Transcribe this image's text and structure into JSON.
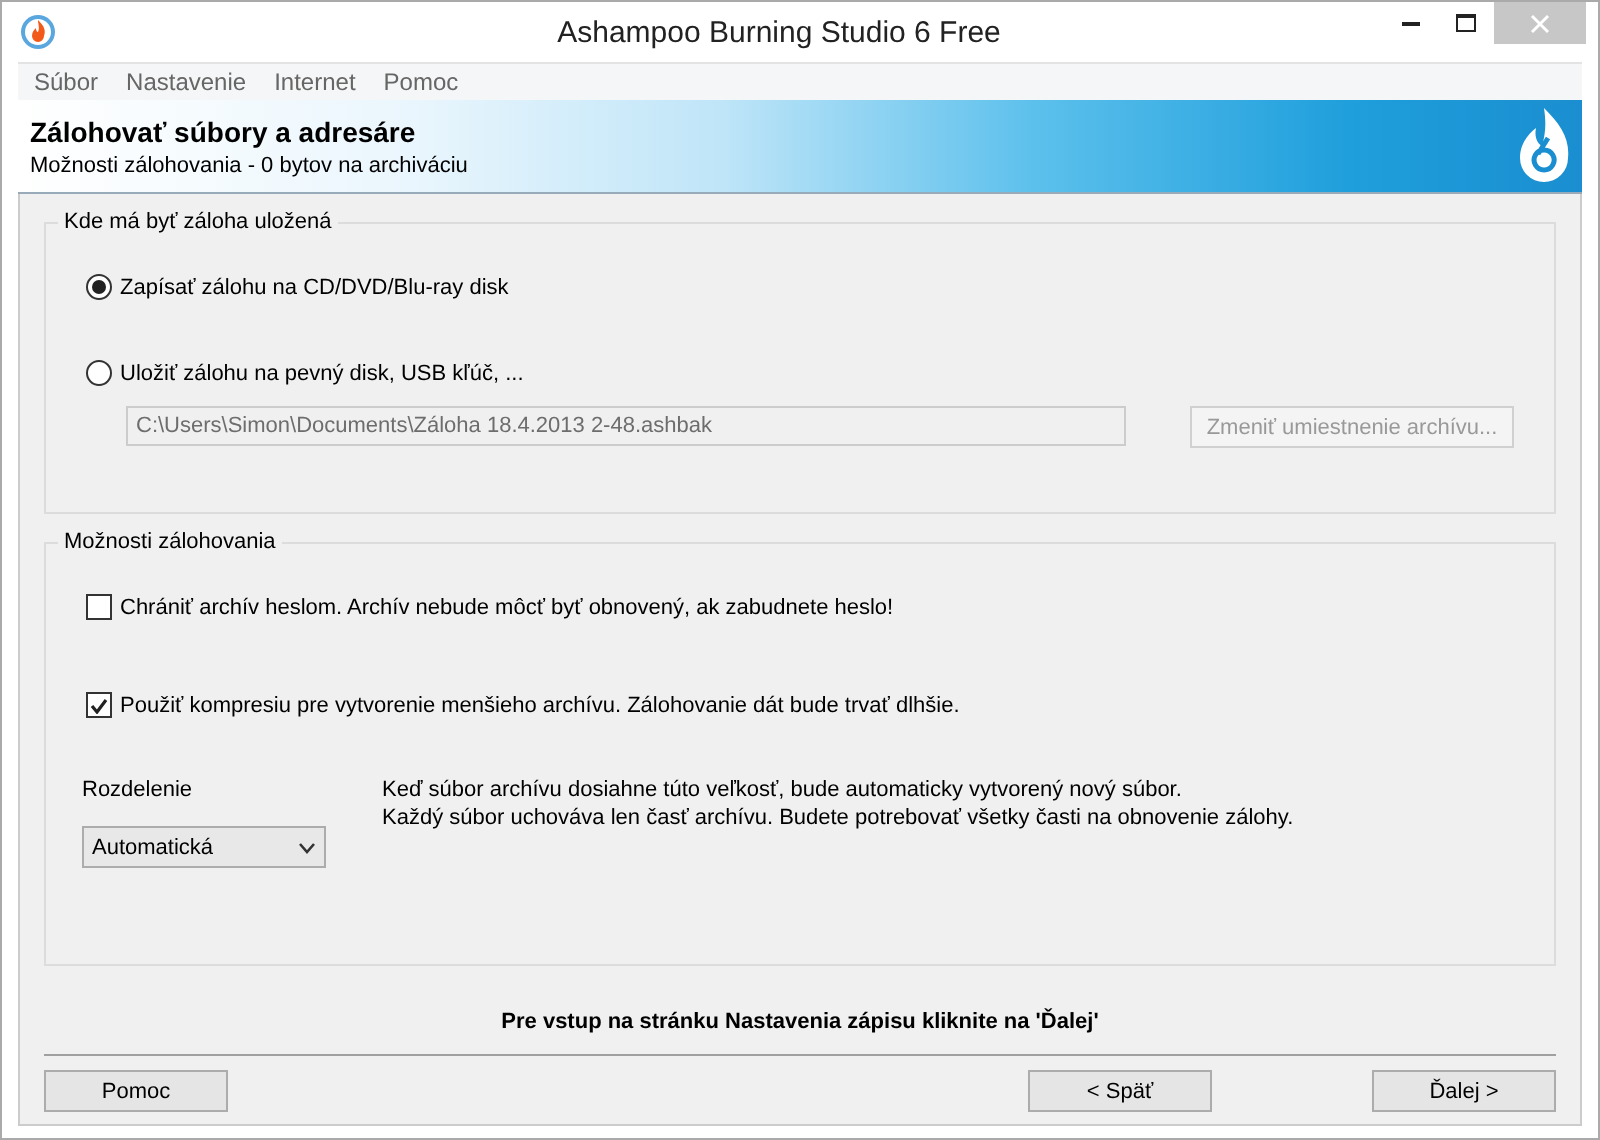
{
  "window": {
    "title": "Ashampoo Burning Studio 6 Free"
  },
  "menu": [
    {
      "label": "Súbor"
    },
    {
      "label": "Nastavenie"
    },
    {
      "label": "Internet"
    },
    {
      "label": "Pomoc"
    }
  ],
  "banner": {
    "title": "Zálohovať súbory a adresáre",
    "subtitle": "Možnosti zálohovania - 0 bytov na archiváciu"
  },
  "location_group": {
    "title": "Kde má byť záloha uložená",
    "options": [
      {
        "label": "Zapísať zálohu na CD/DVD/Blu-ray disk",
        "selected": true
      },
      {
        "label": "Uložiť zálohu na pevný disk, USB kľúč, ...",
        "selected": false
      }
    ],
    "path_field": {
      "value": "C:\\Users\\Simon\\Documents\\Záloha 18.4.2013 2-48.ashbak",
      "disabled": true
    },
    "change_button": {
      "label": "Zmeniť umiestnenie archívu...",
      "disabled": true
    }
  },
  "options_group": {
    "title": "Možnosti zálohovania",
    "checkboxes": [
      {
        "label": "Chrániť archív heslom. Archív nebude môcť byť obnovený, ak zabudnete heslo!",
        "checked": false
      },
      {
        "label": "Použiť kompresiu pre vytvorenie menšieho archívu. Zálohovanie dát bude trvať dlhšie.",
        "checked": true
      }
    ],
    "split": {
      "label": "Rozdelenie",
      "value": "Automatická",
      "description": [
        "Keď súbor archívu dosiahne túto veľkosť, bude automaticky vytvorený nový súbor.",
        "Každý súbor uchováva len časť archívu. Budete potrebovať všetky časti na obnovenie zálohy."
      ]
    }
  },
  "hint": "Pre vstup na stránku Nastavenia zápisu kliknite na 'Ďalej'",
  "buttons": [
    {
      "label": "Pomoc"
    },
    {
      "label": "< Späť"
    },
    {
      "label": "Ďalej >"
    }
  ]
}
